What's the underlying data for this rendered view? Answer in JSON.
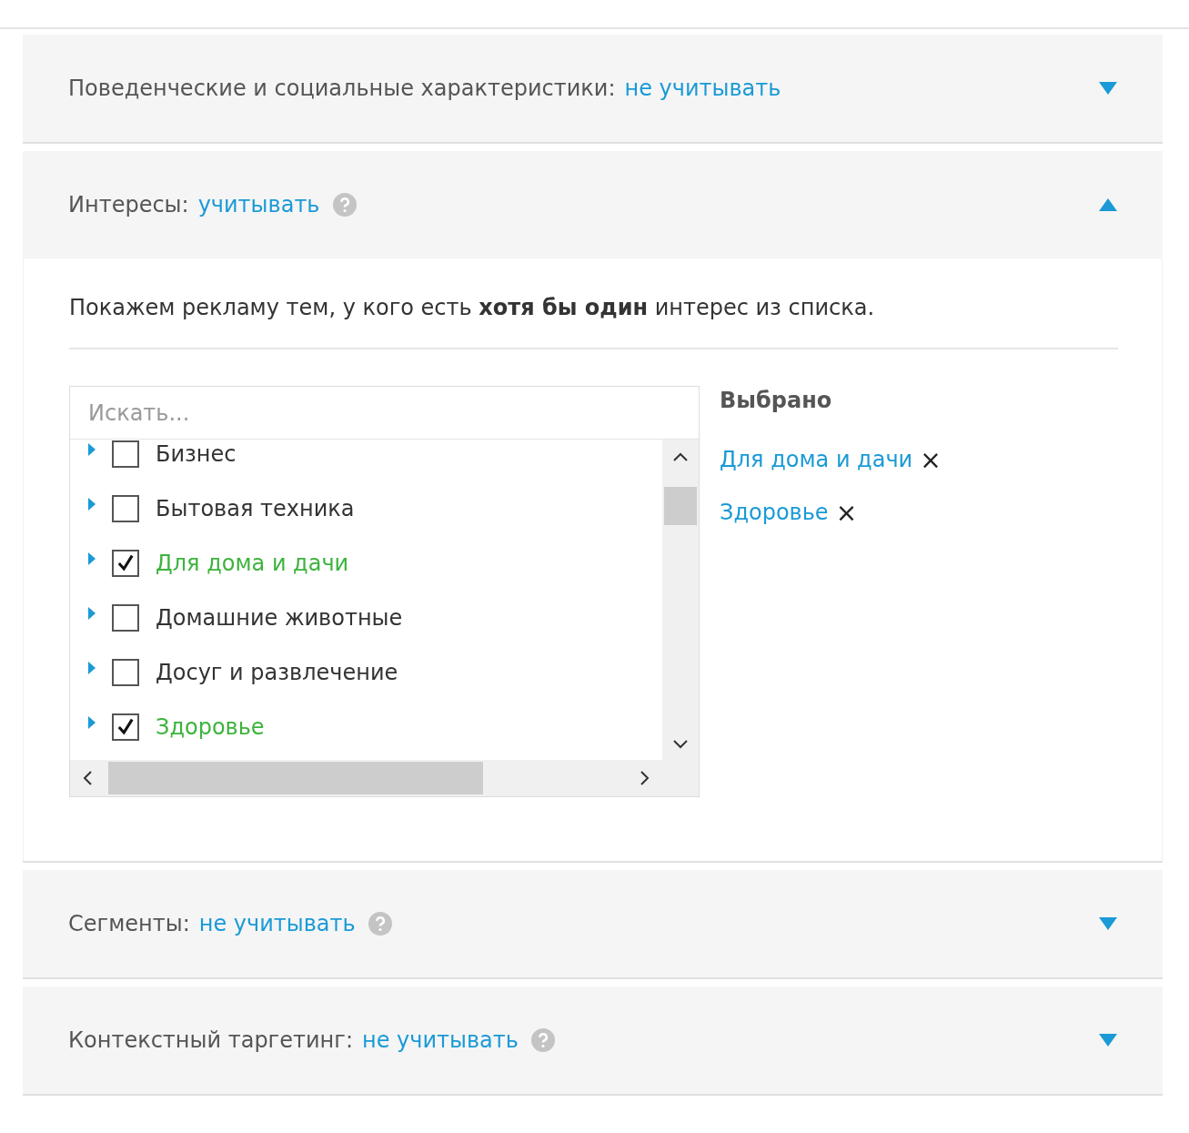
{
  "sections": [
    {
      "label": "Поведенческие и социальные характеристики:",
      "value": "не учитывать",
      "help": false,
      "expanded": false
    },
    {
      "label": "Интересы:",
      "value": "учитывать",
      "help": true,
      "expanded": true,
      "details": {
        "description": "Покажем рекламу тем, у кого есть **хотя бы один** интерес из списка.",
        "search": {
          "placeholder": "Искать..."
        },
        "items": [
          {
            "label": "Бизнес",
            "checked": false
          },
          {
            "label": "Бытовая техника",
            "checked": false
          },
          {
            "label": "Для дома и дачи",
            "checked": true
          },
          {
            "label": "Домашние животные",
            "checked": false
          },
          {
            "label": "Досуг и развлечение",
            "checked": false
          },
          {
            "label": "Здоровье",
            "checked": true
          }
        ],
        "selected_title": "Выбрано",
        "selected": [
          "Для дома и дачи",
          "Здоровье"
        ],
        "remove_glyph": "×"
      }
    },
    {
      "label": "Сегменты:",
      "value": "не учитывать",
      "help": true,
      "expanded": false
    },
    {
      "label": "Контекстный таргетинг:",
      "value": "не учитывать",
      "help": true,
      "expanded": false
    }
  ]
}
